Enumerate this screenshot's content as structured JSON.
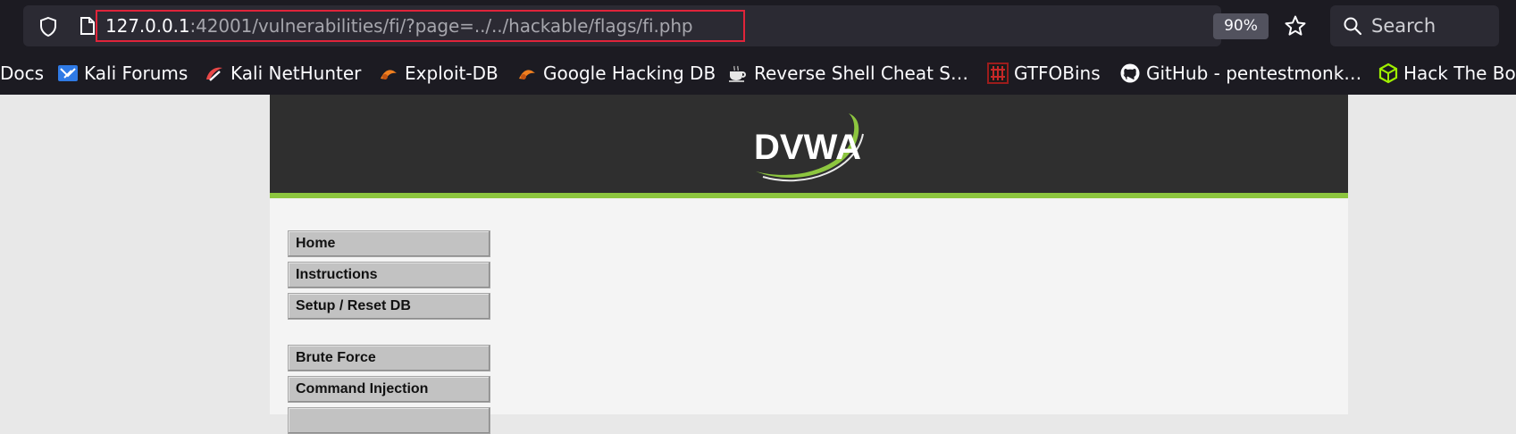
{
  "browser": {
    "url_host": "127.0.0.1",
    "url_rest": ":42001/vulnerabilities/fi/?page=../../hackable/flags/fi.php",
    "zoom": "90%",
    "search_label": "Search",
    "highlight_color": "#e0243a"
  },
  "bookmarks": [
    {
      "label": "Docs",
      "icon": "none"
    },
    {
      "label": "Kali Forums",
      "icon": "kali-forums-icon"
    },
    {
      "label": "Kali NetHunter",
      "icon": "kali-nethunter-icon"
    },
    {
      "label": "Exploit-DB",
      "icon": "exploit-db-icon"
    },
    {
      "label": "Google Hacking DB",
      "icon": "ghdb-icon"
    },
    {
      "label": "Reverse Shell Cheat S…",
      "icon": "coffee-icon"
    },
    {
      "label": "GTFOBins",
      "icon": "gtfobins-icon"
    },
    {
      "label": "GitHub - pentestmonk…",
      "icon": "github-icon"
    },
    {
      "label": "Hack The Bo",
      "icon": "htb-cube-icon"
    }
  ],
  "page": {
    "logo_text": "DVWA",
    "accent_color": "#8dc63f",
    "menu": [
      {
        "label": "Home"
      },
      {
        "label": "Instructions"
      },
      {
        "label": "Setup / Reset DB"
      },
      {
        "label": "Brute Force"
      },
      {
        "label": "Command Injection"
      }
    ]
  }
}
